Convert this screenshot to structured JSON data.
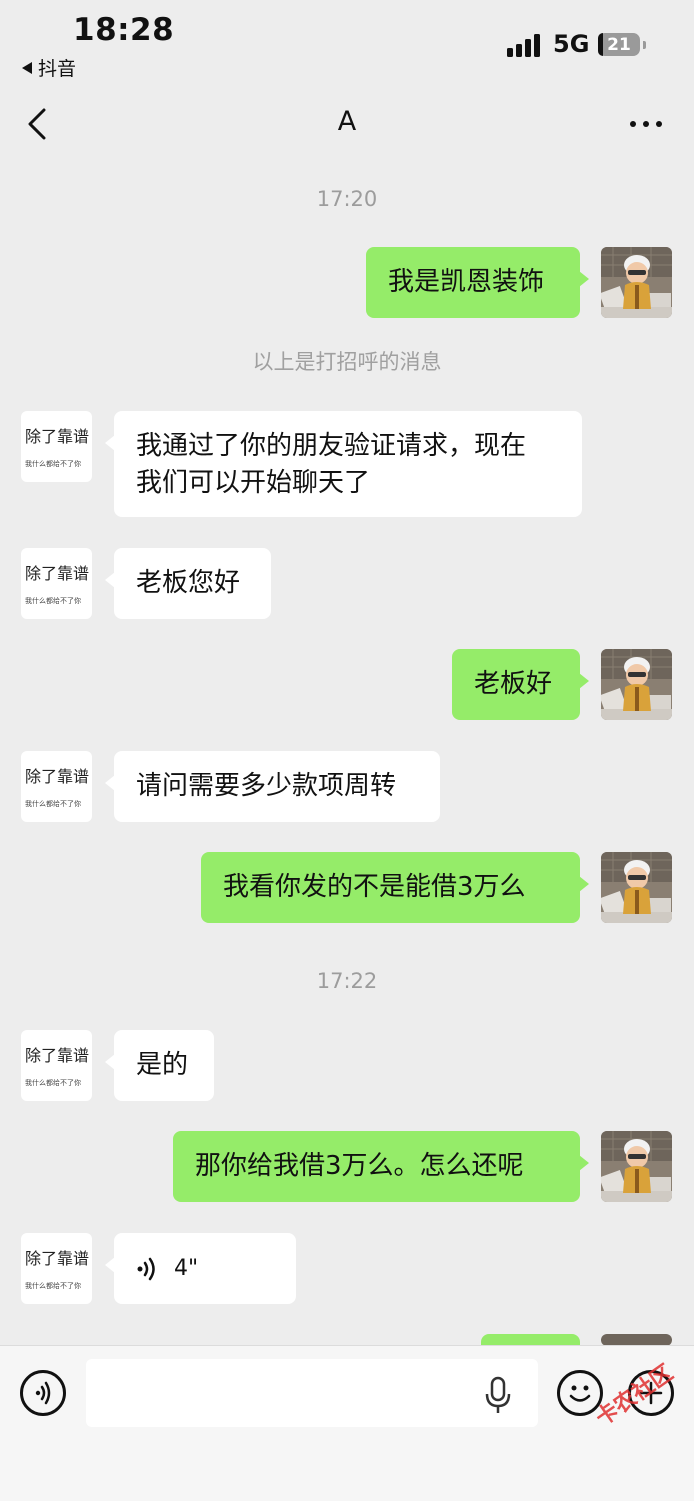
{
  "status_bar": {
    "time": "18:28",
    "back_app_label": "抖音",
    "network": "5G",
    "battery": "21"
  },
  "nav": {
    "title": "A",
    "back_icon": "chevron-left-icon",
    "more_icon": "more-dots-icon"
  },
  "contact": {
    "avatar_line1": "除了靠谱",
    "avatar_line2": "我什么都给不了你"
  },
  "messages": [
    {
      "type": "time",
      "text": "17:20"
    },
    {
      "type": "out",
      "text": "我是凯恩装饰"
    },
    {
      "type": "system",
      "text": "以上是打招呼的消息"
    },
    {
      "type": "in",
      "lines": [
        "我通过了你的朋友验证请求，现在",
        "我们可以开始聊天了"
      ]
    },
    {
      "type": "in",
      "text": "老板您好"
    },
    {
      "type": "out",
      "text": "老板好"
    },
    {
      "type": "in",
      "text": "请问需要多少款项周转"
    },
    {
      "type": "out",
      "text": "我看你发的不是能借3万么"
    },
    {
      "type": "time",
      "text": "17:22"
    },
    {
      "type": "in",
      "text": "是的"
    },
    {
      "type": "out",
      "text": "那你给我借3万么。怎么还呢"
    },
    {
      "type": "in-voice",
      "duration": "4\""
    }
  ],
  "input_bar": {
    "placeholder": "",
    "voice_icon": "voice-mode-icon",
    "mic_icon": "microphone-icon",
    "emoji_icon": "emoji-icon",
    "plus_icon": "plus-icon"
  },
  "watermark": "卡农社区",
  "colors": {
    "background": "#ededed",
    "outgoing_bubble": "#95ec69",
    "incoming_bubble": "#ffffff"
  }
}
